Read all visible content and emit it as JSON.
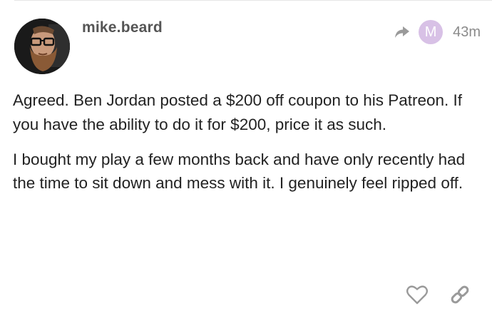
{
  "post": {
    "username": "mike.beard",
    "user_badge_letter": "M",
    "timestamp": "43m",
    "paragraphs": [
      "Agreed. Ben Jordan posted a $200 off coupon to his Patreon. If you have the ability to do it for $200, price it as such.",
      "I bought my play a few months back and have only recently had the time to sit down and mess with it. I genuinely feel ripped off."
    ]
  },
  "icons": {
    "reply": "reply-arrow-icon",
    "like": "heart-icon",
    "share": "link-icon"
  },
  "colors": {
    "badge": "#d8c1e6",
    "username": "#555555",
    "muted": "#8a8a8a",
    "text": "#222222",
    "icon": "#9a9a9a"
  }
}
